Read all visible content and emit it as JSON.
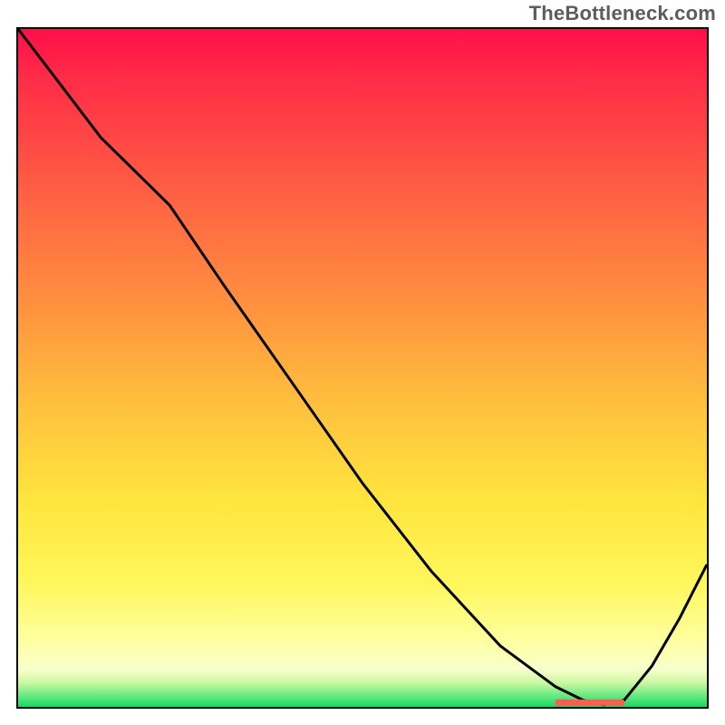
{
  "watermark": "TheBottleneck.com",
  "chart_data": {
    "type": "line",
    "title": "",
    "xlabel": "",
    "ylabel": "",
    "x": [
      0.0,
      0.06,
      0.12,
      0.18,
      0.22,
      0.3,
      0.4,
      0.5,
      0.6,
      0.7,
      0.78,
      0.82,
      0.85,
      0.88,
      0.92,
      0.96,
      1.0
    ],
    "y": [
      1.0,
      0.92,
      0.84,
      0.78,
      0.74,
      0.62,
      0.475,
      0.33,
      0.2,
      0.09,
      0.03,
      0.01,
      0.003,
      0.01,
      0.06,
      0.13,
      0.21
    ],
    "xlim": [
      0,
      1
    ],
    "ylim": [
      0,
      1
    ],
    "marker_band": {
      "x_start": 0.78,
      "x_end": 0.88,
      "y": 0.007
    },
    "gradient_stops": [
      {
        "pos": 0.0,
        "color": "#ff0f4a"
      },
      {
        "pos": 0.22,
        "color": "#ff5944"
      },
      {
        "pos": 0.56,
        "color": "#ffc23d"
      },
      {
        "pos": 0.82,
        "color": "#fff75d"
      },
      {
        "pos": 0.95,
        "color": "#f8ffcb"
      },
      {
        "pos": 1.0,
        "color": "#18d862"
      }
    ]
  },
  "plot": {
    "inner_w": 760,
    "inner_h": 748
  }
}
